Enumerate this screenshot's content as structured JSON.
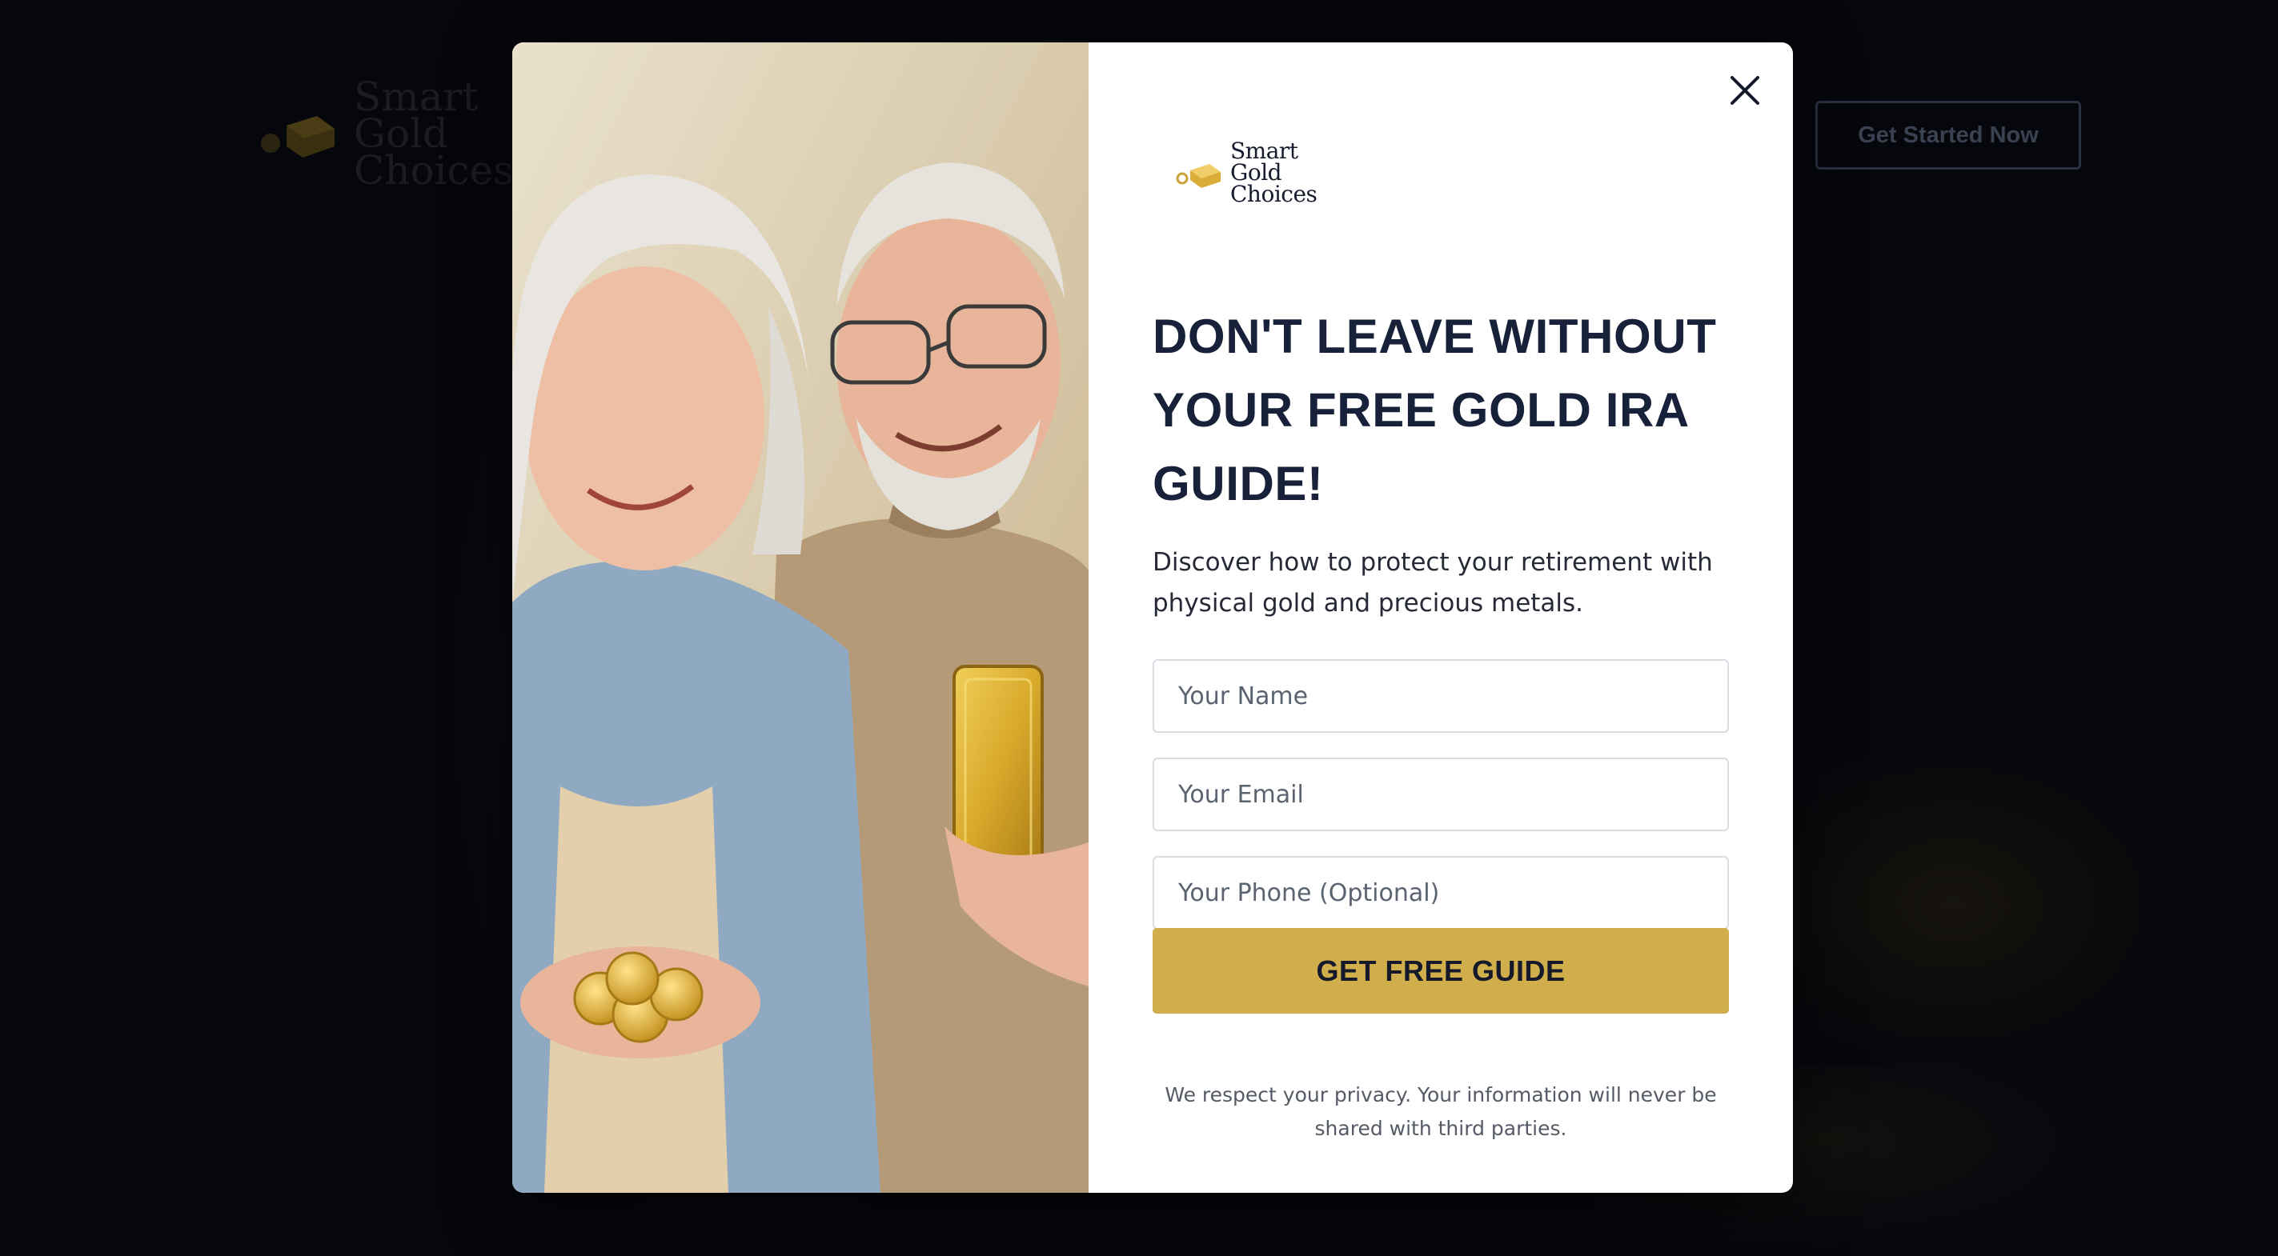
{
  "background_site": {
    "logo_text": "Smart\nGold\nChoices",
    "cta_label": "Get Started Now"
  },
  "modal": {
    "close_icon": "close-icon",
    "brand_text": "Smart\nGold\nChoices",
    "headline": "DON'T LEAVE WITHOUT YOUR FREE GOLD IRA GUIDE!",
    "subheadline": "Discover how to protect your retirement with physical gold and precious metals.",
    "form": {
      "name_placeholder": "Your Name",
      "email_placeholder": "Your Email",
      "phone_placeholder": "Your Phone (Optional)",
      "submit_label": "GET FREE GUIDE"
    },
    "privacy_note": "We respect your privacy. Your information will never be shared with third parties."
  },
  "colors": {
    "backdrop": "#05070d",
    "headline": "#17213a",
    "gold_button": "#cfae4b",
    "modal_bg": "#ffffff"
  }
}
